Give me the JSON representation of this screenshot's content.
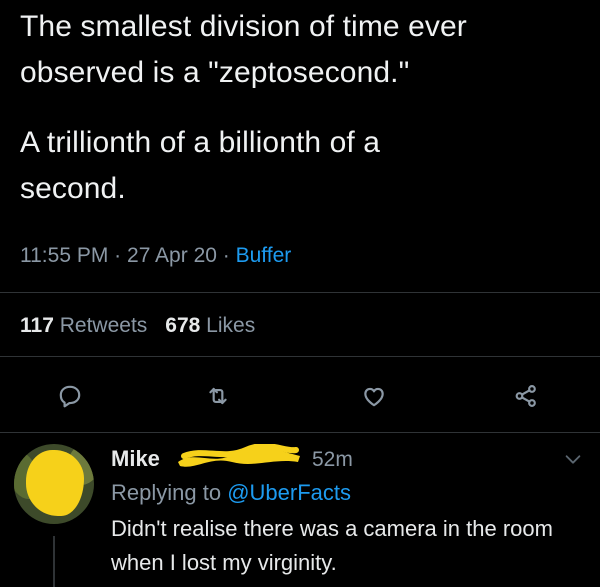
{
  "tweet": {
    "line1": "The smallest division of time ever",
    "line2": "observed is a \"zeptosecond.\"",
    "line3": "A trillionth of a billionth of a",
    "line4": "second.",
    "time": "11:55 PM",
    "date": "27 Apr 20",
    "separator": "·",
    "source": "Buffer"
  },
  "stats": {
    "retweets_count": "117",
    "retweets_label": "Retweets",
    "likes_count": "678",
    "likes_label": "Likes"
  },
  "actions": {
    "icons": [
      "reply-icon",
      "retweet-icon",
      "like-icon",
      "share-icon"
    ],
    "stroke_color": "#8b98a5"
  },
  "reply": {
    "name": "Mike",
    "time": "52m",
    "replying_prefix": "Replying to",
    "replying_handle": "@UberFacts",
    "text": "Didn't realise there was a camera in the room when I lost my virginity.",
    "scribble_color": "#f6d11a"
  },
  "colors": {
    "background": "#000000",
    "text": "#e7e9ea",
    "muted": "#8b98a5",
    "accent": "#1d9bf0"
  }
}
